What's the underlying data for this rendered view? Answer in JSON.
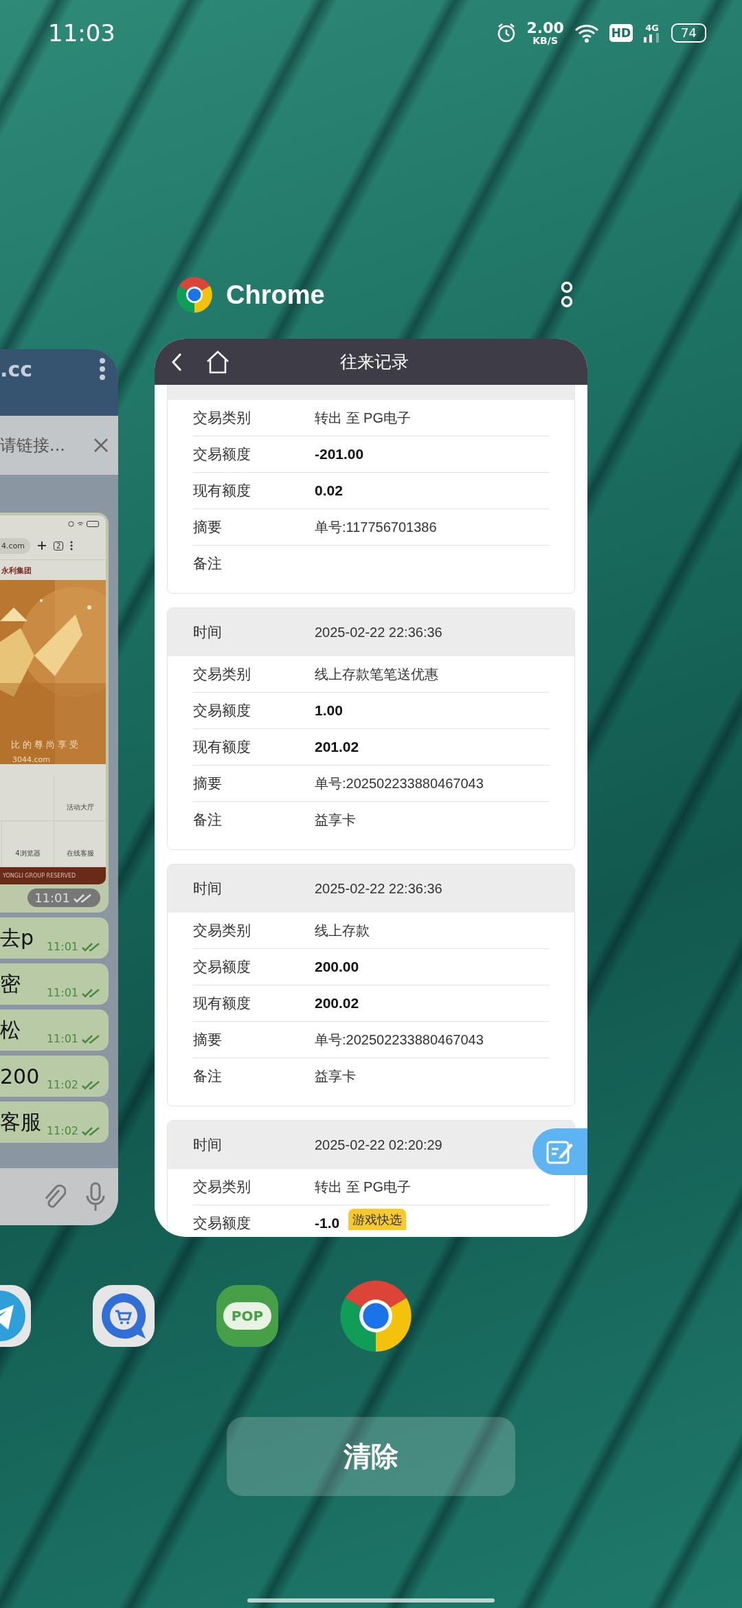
{
  "status_bar": {
    "time": "11:03",
    "net_speed": "2.00",
    "net_unit": "KB/S",
    "hd": "HD",
    "network": "4G",
    "battery": "74"
  },
  "side_card": {
    "title": ".cc",
    "banner": "请链接...",
    "shared_screenshot": {
      "url": "4.com",
      "tab_count": "2",
      "brand": "永利集团",
      "slogan": "比的尊尚享受",
      "site": "3044.com",
      "menu": [
        {
          "cells": [
            "活动大厅"
          ]
        },
        {
          "cells": [
            "4浏览器",
            "在线客服"
          ]
        }
      ],
      "footer": "YONGLI GROUP RESERVED"
    },
    "image_time": "11:01",
    "messages": [
      {
        "text": "去p",
        "time": "11:01"
      },
      {
        "text": "密",
        "time": "11:01"
      },
      {
        "text": "松",
        "time": "11:01"
      },
      {
        "text": "200",
        "time": "11:02"
      },
      {
        "text": "客服",
        "time": "11:02"
      }
    ]
  },
  "active_card": {
    "app_name": "Chrome",
    "page_title": "往来记录",
    "floating_badge": "游戏快选",
    "records": [
      {
        "header_hidden": true,
        "rows": [
          {
            "kind": "plain",
            "label": "交易类别",
            "value": "转出 至 PG电子"
          },
          {
            "kind": "amount",
            "label": "交易额度",
            "value": "-201.00"
          },
          {
            "kind": "amount",
            "label": "现有额度",
            "value": "0.02"
          },
          {
            "kind": "plain",
            "label": "摘要",
            "value": "单号:117756701386"
          },
          {
            "kind": "plain",
            "label": "备注"
          }
        ]
      },
      {
        "header_hidden": false,
        "rows": [
          {
            "kind": "header",
            "label": "时间",
            "value": "2025-02-22 22:36:36"
          },
          {
            "kind": "plain",
            "label": "交易类别",
            "value": "线上存款笔笔送优惠"
          },
          {
            "kind": "amount",
            "label": "交易额度",
            "value": "1.00"
          },
          {
            "kind": "amount",
            "label": "现有额度",
            "value": "201.02"
          },
          {
            "kind": "plain",
            "label": "摘要",
            "value": "单号:202502233880467043"
          },
          {
            "kind": "plain",
            "label": "备注",
            "value": "益享卡"
          }
        ]
      },
      {
        "header_hidden": false,
        "rows": [
          {
            "kind": "header",
            "label": "时间",
            "value": "2025-02-22 22:36:36"
          },
          {
            "kind": "plain",
            "label": "交易类别",
            "value": "线上存款"
          },
          {
            "kind": "amount",
            "label": "交易额度",
            "value": "200.00"
          },
          {
            "kind": "amount",
            "label": "现有额度",
            "value": "200.02"
          },
          {
            "kind": "plain",
            "label": "摘要",
            "value": "单号:202502233880467043"
          },
          {
            "kind": "plain",
            "label": "备注",
            "value": "益享卡"
          }
        ]
      },
      {
        "header_hidden": false,
        "rows": [
          {
            "kind": "header",
            "label": "时间",
            "value": "2025-02-22 02:20:29"
          },
          {
            "kind": "plain",
            "label": "交易类别",
            "value": "转出 至 PG电子"
          },
          {
            "kind": "amount",
            "label": "交易额度",
            "value": "-1.0"
          }
        ]
      }
    ]
  },
  "dock": [
    {
      "kind": "telegram"
    },
    {
      "kind": "shop"
    },
    {
      "kind": "pop",
      "label": "POP"
    },
    {
      "kind": "chrome"
    }
  ],
  "clear_button": "清除"
}
